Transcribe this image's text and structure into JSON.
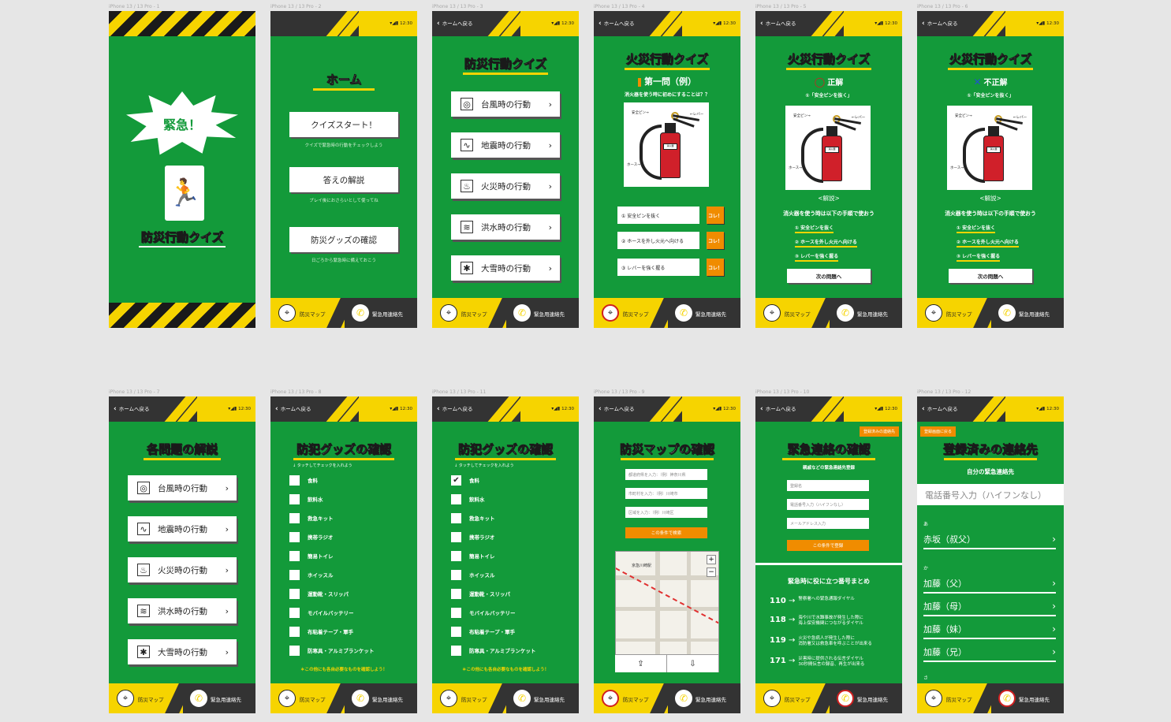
{
  "frames": {
    "labels": [
      "iPhone 13 / 13 Pro - 1",
      "iPhone 13 / 13 Pro - 2",
      "iPhone 13 / 13 Pro - 3",
      "iPhone 13 / 13 Pro - 4",
      "iPhone 13 / 13 Pro - 5",
      "iPhone 13 / 13 Pro - 6",
      "iPhone 13 / 13 Pro - 7",
      "iPhone 13 / 13 Pro - 8",
      "iPhone 13 / 13 Pro - 11",
      "iPhone 13 / 13 Pro - 9",
      "iPhone 13 / 13 Pro - 10",
      "iPhone 13 / 13 Pro - 12"
    ]
  },
  "common": {
    "back": "ホームへ戻る",
    "time": "12:30",
    "footer_map": "防災マップ",
    "footer_contact": "緊急用連絡先"
  },
  "splash": {
    "burst": "緊急！",
    "title": "防災行動クイズ"
  },
  "home": {
    "title": "ホーム",
    "buttons": [
      {
        "label": "クイズスタート！",
        "caption": "クイズで緊急時の行動をチェックしよう"
      },
      {
        "label": "答えの解説",
        "caption": "プレイ後におさらいとして使ってね"
      },
      {
        "label": "防災グッズの確認",
        "caption": "日ごろから緊急時に備えておこう"
      }
    ]
  },
  "categories": {
    "title": "防災行動クイズ",
    "items": [
      {
        "label": "台風時の行動",
        "icon": "typhoon-icon",
        "glyph": "◎"
      },
      {
        "label": "地震時の行動",
        "icon": "earthquake-icon",
        "glyph": "∿"
      },
      {
        "label": "火災時の行動",
        "icon": "fire-icon",
        "glyph": "♨"
      },
      {
        "label": "洪水時の行動",
        "icon": "flood-icon",
        "glyph": "≋"
      },
      {
        "label": "大雪時の行動",
        "icon": "snow-icon",
        "glyph": "✱"
      }
    ]
  },
  "quiz": {
    "title": "火災行動クイズ",
    "question_no": "第一問（例）",
    "question": "消火器を使う時に初めにすることは？？",
    "labels": {
      "pin": "安全ピン→",
      "lever": "←レバー",
      "hose": "ホース→"
    },
    "options": [
      "① 安全ピンを抜く",
      "② ホースを外し火元へ向ける",
      "③ レバーを強く握る"
    ],
    "choose": "コレ！",
    "tag": "消火器"
  },
  "result_ok": {
    "mark": "正解",
    "answer": "①「安全ピンを抜く」",
    "explain_head": "<解説>",
    "explain_lead": "消火器を使う時は以下の手順で使おう",
    "steps": [
      "① 安全ピンを抜く",
      "② ホースを外し火元へ向ける",
      "③ レバーを強く握る"
    ],
    "next": "次の問題へ"
  },
  "result_ng": {
    "mark": "不正解",
    "answer": "①「安全ピンを抜く」"
  },
  "explanations": {
    "title": "各問題の解説"
  },
  "goods": {
    "title": "防犯グッズの確認",
    "hint": "タッチしてチェックを入れよう",
    "items": [
      "食料",
      "飲料水",
      "救急キット",
      "携帯ラジオ",
      "簡易トイレ",
      "ホイッスル",
      "運動靴・スリッパ",
      "モバイルバッテリー",
      "布粘着テープ・軍手",
      "防寒具・アルミブランケット"
    ],
    "footer_note": "＊この他にも各自必要なものを確認しよう！",
    "checkmark": "✔"
  },
  "map": {
    "title": "防災マップの確認",
    "inputs": [
      "都道府県を入力：（例）神奈川県",
      "市町村を入力：（例）川崎市",
      "区域を入力：（例）川崎区"
    ],
    "search": "この条件で検索",
    "zoom_in": "+",
    "zoom_out": "−",
    "place": "京急川崎駅",
    "share": "⇪",
    "download": "⇩"
  },
  "emergency": {
    "title": "緊急連絡の確認",
    "registered_tab": "登録済みの連絡先",
    "lead": "親戚などの緊急連絡先登録",
    "inputs": [
      "登録名",
      "電話番号入力（ハイフンなし）",
      "メールアドレス入力"
    ],
    "submit": "この条件で登録",
    "numbers_title": "緊急時に役に立つ番号まとめ",
    "numbers": [
      {
        "n": "110",
        "d1": "警察署への緊急通報ダイヤル",
        "d2": ""
      },
      {
        "n": "118",
        "d1": "海や川で水難事故が発生した際に",
        "d2": "海上保安機関につながるダイヤル"
      },
      {
        "n": "119",
        "d1": "火災や急病人が発生した際に",
        "d2": "消防署又は救急車を呼ぶことが出来る"
      },
      {
        "n": "171",
        "d1": "災害時に提供される伝言ダイヤル",
        "d2": "30秒間伝言の録音、再生が出来る"
      }
    ]
  },
  "contacts": {
    "back": "登録画面に戻る",
    "title": "登録済みの連絡先",
    "subtitle": "自分の緊急連絡先",
    "phone_placeholder": "電話番号入力（ハイフンなし）",
    "kana": [
      "あ",
      "か",
      "さ"
    ],
    "list_a": [
      "赤坂（叔父）"
    ],
    "list_k": [
      "加藤（父）",
      "加藤（母）",
      "加藤（妹）",
      "加藤（兄）"
    ]
  },
  "colors": {
    "green": "#139a3a",
    "yellow": "#f6d400",
    "dark": "#333333",
    "orange": "#f08c00",
    "red": "#d02020"
  }
}
